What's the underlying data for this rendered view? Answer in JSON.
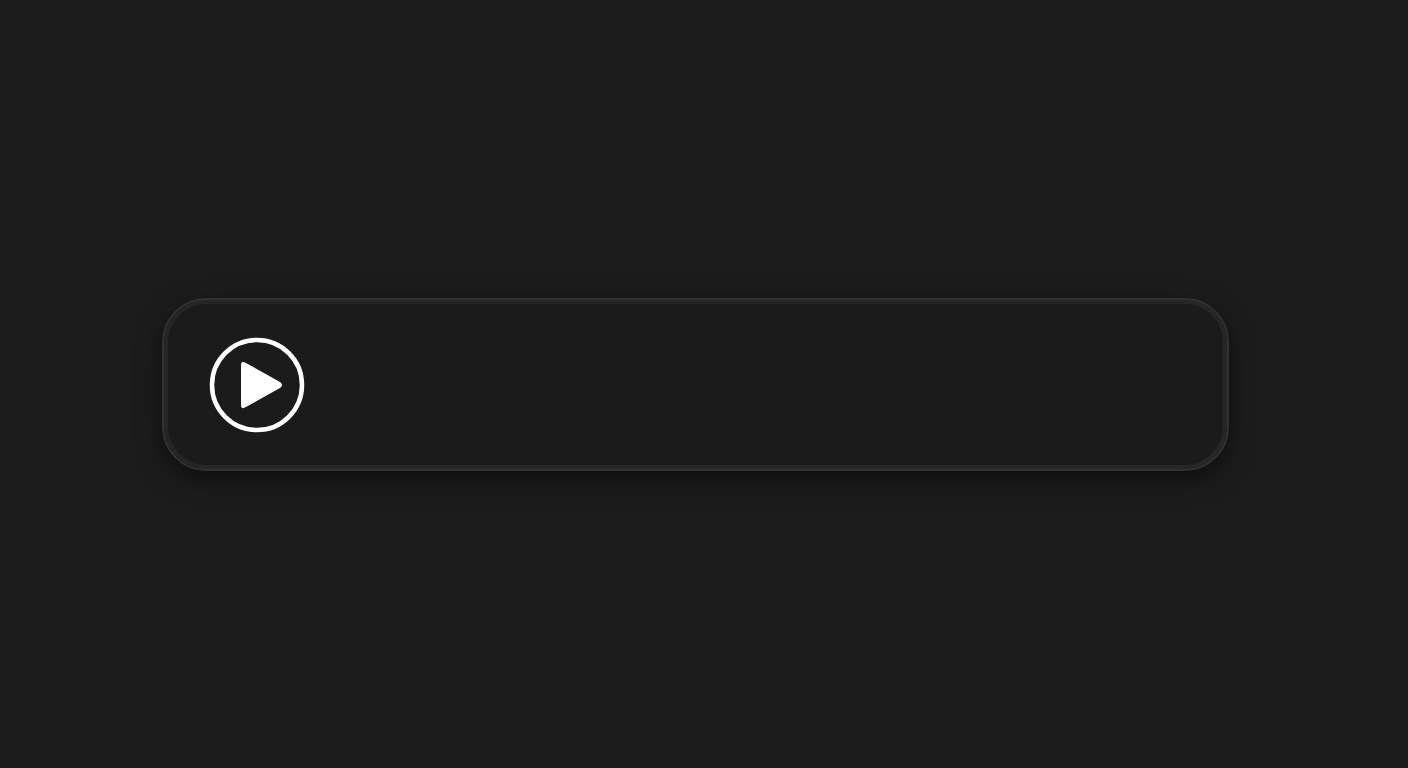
{
  "player": {
    "playing": false
  }
}
